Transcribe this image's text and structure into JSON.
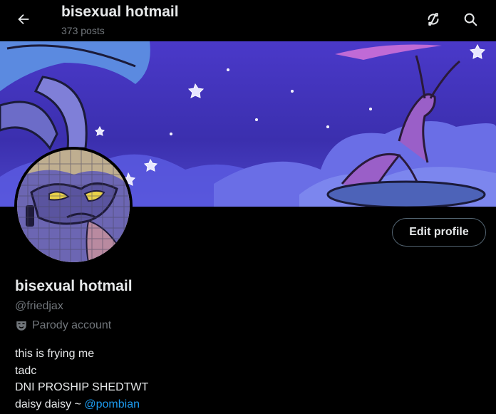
{
  "header": {
    "title": "bisexual hotmail",
    "post_count": "373 posts",
    "back_icon": "arrow-left-icon",
    "rotate_icon": "refresh-slash-icon",
    "search_icon": "search-icon"
  },
  "profile": {
    "display_name": "bisexual hotmail",
    "handle": "@friedjax",
    "label": "Parody account",
    "label_icon": "parody-mask-icon",
    "edit_button": "Edit profile",
    "bio": {
      "line1": "this is frying me",
      "line2": "tadc",
      "line3": "DNI PROSHIP SHEDTWT",
      "line4_prefix": "daisy daisy ~ ",
      "line4_mention": "@pombian"
    }
  },
  "colors": {
    "background": "#000000",
    "text_primary": "#e7e9ea",
    "text_secondary": "#71767b",
    "link": "#1d9bf0",
    "button_border": "#536471"
  }
}
